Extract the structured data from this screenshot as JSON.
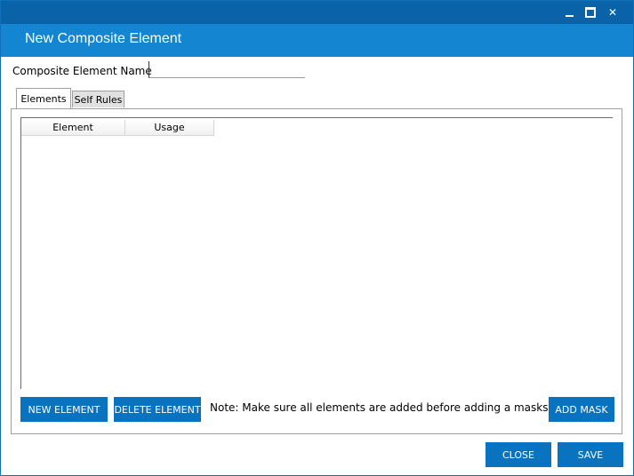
{
  "window": {
    "title": "",
    "controls": {
      "minimize_icon": "minimize-icon",
      "maximize_icon": "maximize-icon",
      "close_glyph": "✕"
    }
  },
  "header": {
    "title": "New Composite Element"
  },
  "form": {
    "name_label": "Composite Element Name",
    "name_value": "",
    "name_placeholder": ""
  },
  "tabs": [
    {
      "label": "Elements",
      "active": true
    },
    {
      "label": "Self Rules",
      "active": false
    }
  ],
  "grid": {
    "columns": [
      "Element",
      "Usage"
    ],
    "rows": []
  },
  "panel_actions": {
    "new_element_label": "NEW ELEMENT",
    "delete_element_label": "DELETE ELEMENT",
    "note": "Note: Make sure all elements are added before adding a masks",
    "add_mask_label": "ADD MASK"
  },
  "footer": {
    "close_label": "CLOSE",
    "save_label": "SAVE"
  },
  "colors": {
    "titlebar": "#0a63a8",
    "header": "#1385d1",
    "button": "#0a73c0"
  }
}
